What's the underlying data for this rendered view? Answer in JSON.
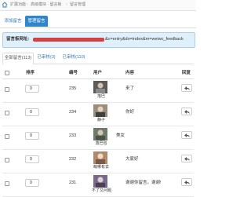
{
  "breadcrumb": {
    "items": [
      "扩展功能",
      "高级模块 · 留言板",
      "留言管理"
    ]
  },
  "tabs": {
    "add": "添加留言",
    "manage": "管理留言"
  },
  "url_box": {
    "label": "留言板网址:",
    "redacted_prefix": "redacted",
    "suffix": "&c=entry&do=index&m=weiwc_feedback"
  },
  "subtabs": [
    "全部留言(113)",
    "已审核(3)",
    "已审核(110)"
  ],
  "table": {
    "headers": {
      "order": "排序",
      "num": "编号",
      "user": "用户",
      "content": "内容",
      "reply": "回复"
    },
    "rows": [
      {
        "order": "0",
        "num": "235",
        "user": "落巴",
        "content": "来了"
      },
      {
        "order": "0",
        "num": "234",
        "user": "静子",
        "content": "你好"
      },
      {
        "order": "0",
        "num": "233",
        "user": "落巴包",
        "content": "美女"
      },
      {
        "order": "0",
        "num": "232",
        "user": "萌哪有去",
        "content": "大家好"
      },
      {
        "order": "0",
        "num": "231",
        "user": "不了又问题",
        "content": "谢谢你留言。谢谢!"
      }
    ]
  },
  "colors": {
    "accent": "#2f86c9",
    "url_box_bg": "#dff0fb",
    "redaction": "#d54040"
  }
}
